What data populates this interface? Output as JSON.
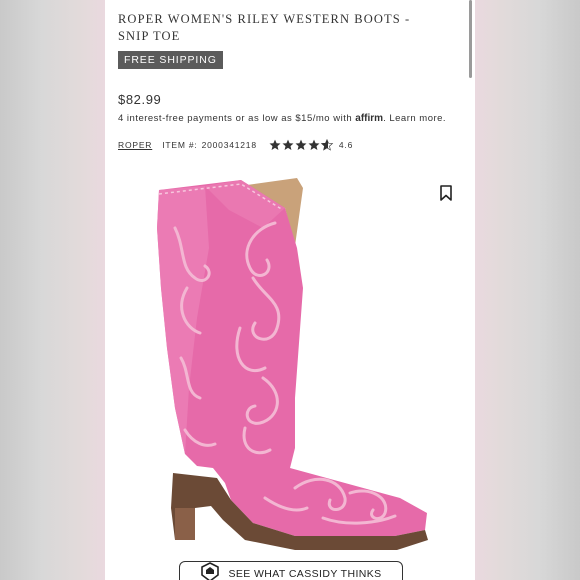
{
  "product": {
    "title": "ROPER WOMEN'S RILEY WESTERN BOOTS - SNIP TOE",
    "shipping_badge": "FREE SHIPPING",
    "price": "$82.99",
    "installments_prefix": "4 interest-free payments or as low as $15/mo with",
    "affirm_label": "affirm",
    "learn_more": ". Learn more.",
    "brand": "ROPER",
    "item_label": "ITEM #:",
    "item_number": "2000341218",
    "rating": 4.6,
    "rating_label": "4.6",
    "rating_max": 5
  },
  "image": {
    "icon": "pink-cowboy-boot",
    "boot_color": "#e66aa9",
    "stitch_color": "#f3b6d2",
    "sole_color": "#6b4a36"
  },
  "actions": {
    "bookmark_icon": "bookmark-icon",
    "review_button_label": "SEE WHAT CASSIDY THINKS",
    "review_icon": "badge-icon"
  }
}
